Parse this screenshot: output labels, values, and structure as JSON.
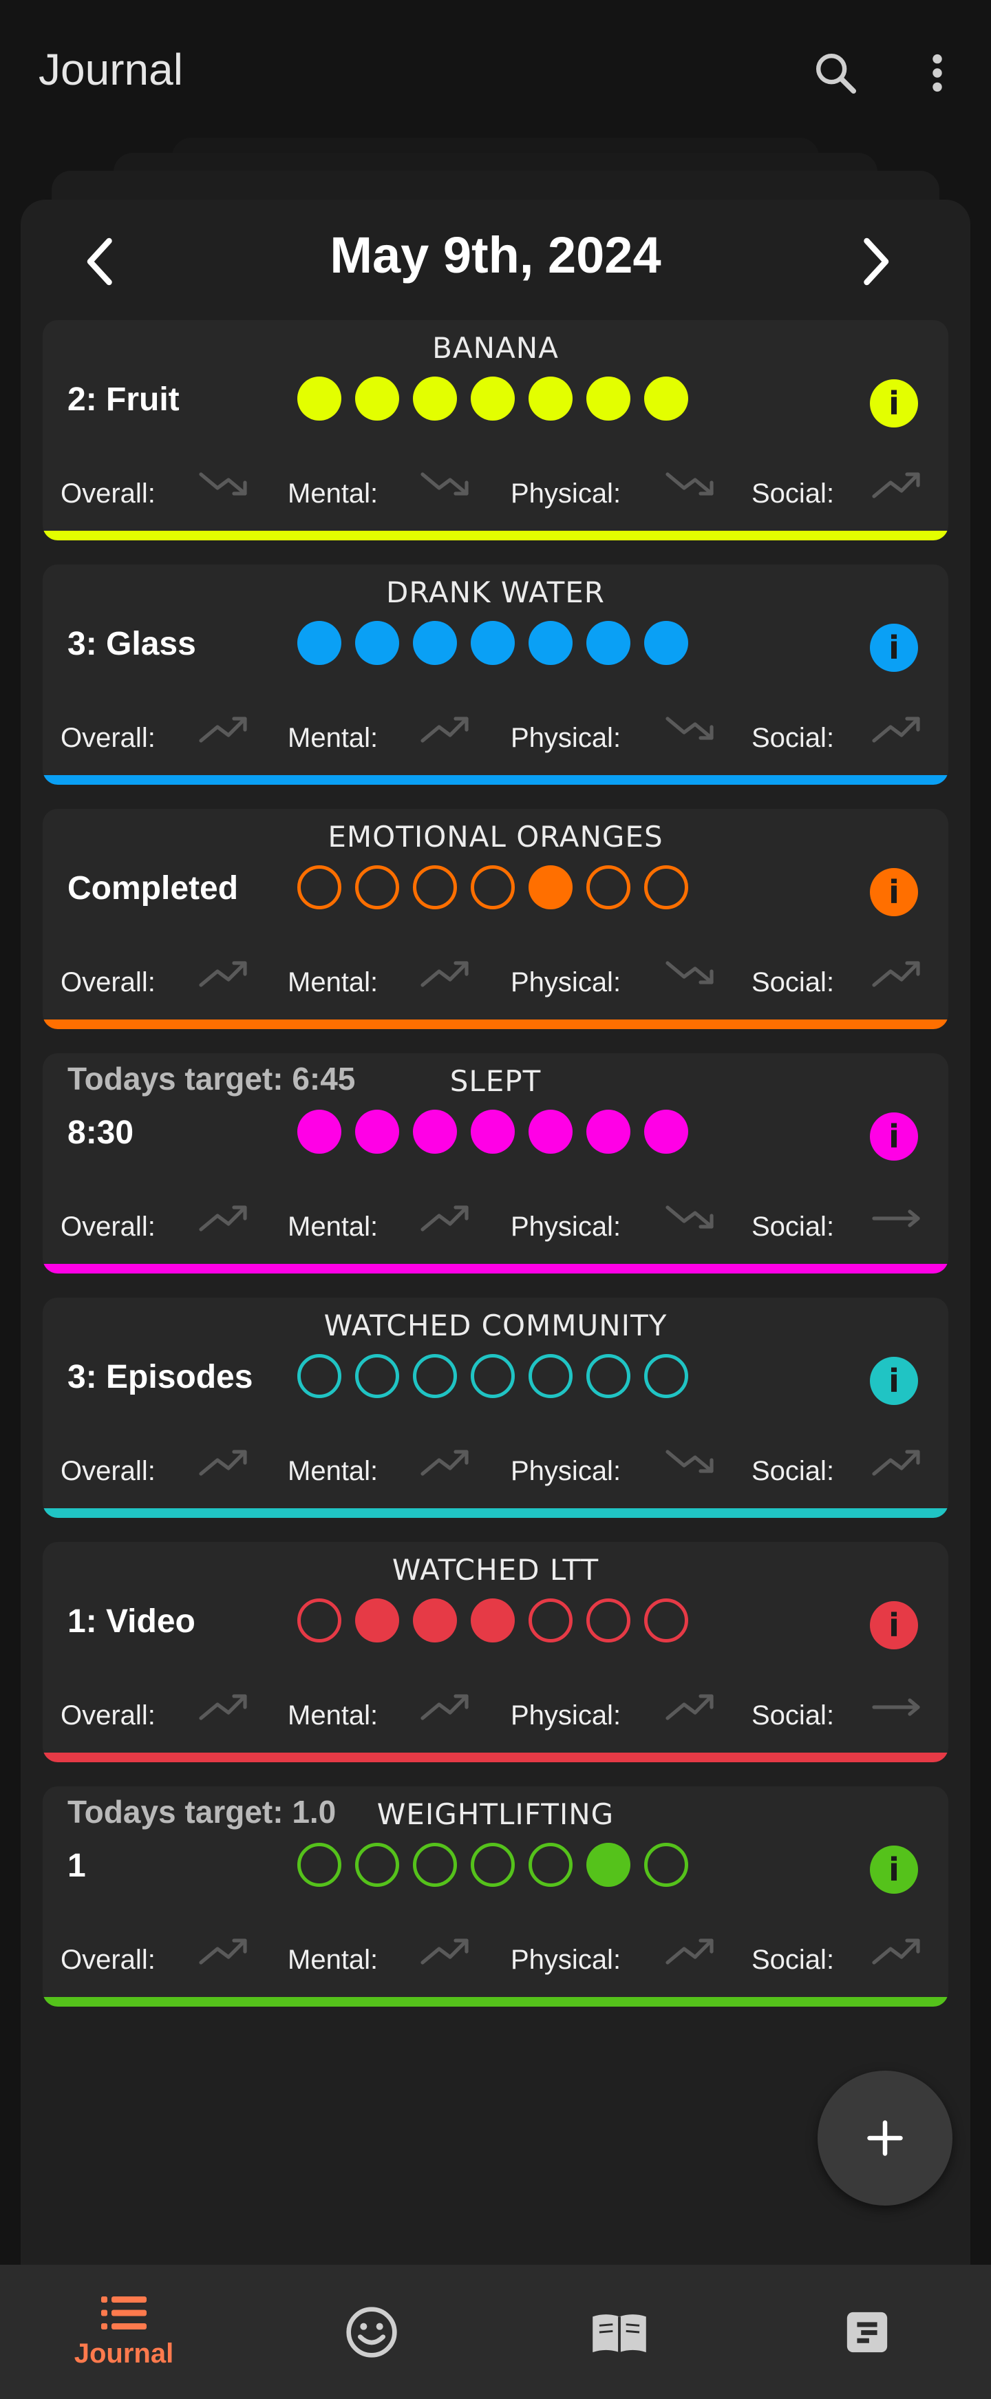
{
  "app_title": "Journal",
  "date_title": "May 9th, 2024",
  "metric_labels": {
    "overall": "Overall:",
    "mental": "Mental:",
    "physical": "Physical:",
    "social": "Social:"
  },
  "cards": [
    {
      "name": "BANANA",
      "value": "2: Fruit",
      "target": "",
      "color": "#e3ff00",
      "dots": [
        1,
        1,
        1,
        1,
        1,
        1,
        1
      ],
      "trends": [
        "down",
        "down",
        "down",
        "up"
      ]
    },
    {
      "name": "DRANK WATER",
      "value": "3: Glass",
      "target": "",
      "color": "#0aa0f5",
      "dots": [
        1,
        1,
        1,
        1,
        1,
        1,
        1
      ],
      "trends": [
        "up",
        "up",
        "down",
        "up"
      ]
    },
    {
      "name": "EMOTIONAL ORANGES",
      "value": "Completed",
      "target": "",
      "color": "#ff6f00",
      "dots": [
        0,
        0,
        0,
        0,
        1,
        0,
        0
      ],
      "trends": [
        "up",
        "up",
        "down",
        "up"
      ]
    },
    {
      "name": "SLEPT",
      "value": "8:30",
      "target": "Todays target: 6:45",
      "color": "#ff00e6",
      "dots": [
        1,
        1,
        1,
        1,
        1,
        1,
        1
      ],
      "trends": [
        "up",
        "up",
        "down",
        "flat"
      ]
    },
    {
      "name": "WATCHED COMMUNITY",
      "value": "3: Episodes",
      "target": "",
      "color": "#20c4c4",
      "dots": [
        0,
        0,
        0,
        0,
        0,
        0,
        0
      ],
      "trends": [
        "up",
        "up",
        "down",
        "up"
      ]
    },
    {
      "name": "WATCHED LTT",
      "value": "1: Video",
      "target": "",
      "color": "#e63a46",
      "dots": [
        0,
        1,
        1,
        1,
        0,
        0,
        0
      ],
      "trends": [
        "up",
        "up",
        "up",
        "flat"
      ]
    },
    {
      "name": "WEIGHTLIFTING",
      "value": "1",
      "target": "Todays target: 1.0",
      "color": "#55c21b",
      "dots": [
        0,
        0,
        0,
        0,
        0,
        1,
        0
      ],
      "trends": [
        "up",
        "up",
        "up",
        "up"
      ]
    }
  ],
  "bottom_nav": {
    "active_color": "#ff7a4d",
    "tabs": [
      {
        "label": "Journal",
        "icon": "list-icon"
      },
      {
        "label": "",
        "icon": "smiley-icon"
      },
      {
        "label": "",
        "icon": "book-icon"
      },
      {
        "label": "",
        "icon": "notes-icon"
      }
    ]
  },
  "icons": {
    "search": "search-icon",
    "menu": "more-vertical-icon",
    "prev": "chevron-left-icon",
    "next": "chevron-right-icon",
    "fab": "plus-icon"
  }
}
